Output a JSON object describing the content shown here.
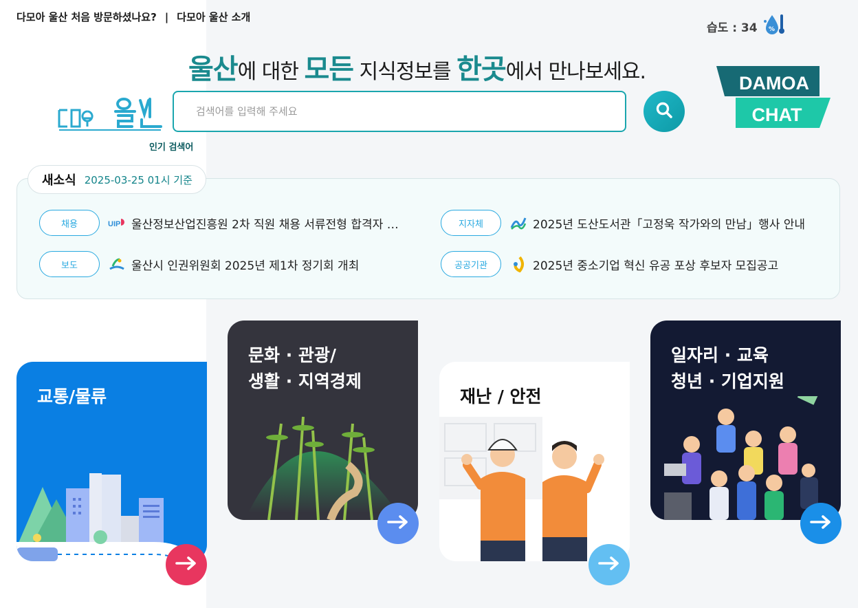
{
  "top_links": {
    "first_visit": "다모아 울산 처음 방문하셨나요?",
    "separator": "|",
    "about": "다모아 울산 소개"
  },
  "weather": {
    "humidity_label": "습도 : 34",
    "icon": "humidity-drop-icon"
  },
  "headline": {
    "part1_em": "울산",
    "part2": "에 대한 ",
    "part3_em": "모든",
    "part4": " 지식정보를 ",
    "part5_em": "한곳",
    "part6": "에서 만나보세요."
  },
  "logo": {
    "alt": "다모아 울산"
  },
  "search": {
    "placeholder": "검색어를 입력해 주세요",
    "value": ""
  },
  "chat_badge": {
    "line1": "DAMOA",
    "line2": "CHAT"
  },
  "popular_keywords_label": "인기 검색어",
  "news": {
    "title": "새소식",
    "timestamp": "2025-03-25 01시 기준",
    "items": [
      {
        "tag": "채용",
        "icon": "uipa-logo-icon",
        "text": "울산정보산업진흥원 2차 직원 채용 서류전형 합격자 및 ..."
      },
      {
        "tag": "지자체",
        "icon": "dongnam-district-logo-icon",
        "text": "2025년 도산도서관「고정욱 작가와의 만남」행사 안내"
      },
      {
        "tag": "보도",
        "icon": "ulsan-city-logo-icon",
        "text": "울산시 인권위원회 2025년 제1차 정기회 개최"
      },
      {
        "tag": "공공기관",
        "icon": "public-agency-logo-icon",
        "text": "2025년 중소기업 혁신 유공 포상 후보자 모집공고"
      }
    ]
  },
  "categories": [
    {
      "label": "교통/물류",
      "color": "#0a7fe3",
      "arrow_color": "#e8365f"
    },
    {
      "label": "문화 · 관광/\n생활 · 지역경제",
      "color": "#34343d",
      "arrow_color": "#5b8def"
    },
    {
      "label": "재난 / 안전",
      "color": "#ffffff",
      "arrow_color": "#63bff2"
    },
    {
      "label": "일자리  ·  교육\n청년  ·  기업지원",
      "color": "#131a33",
      "arrow_color": "#1a8fe8"
    }
  ]
}
